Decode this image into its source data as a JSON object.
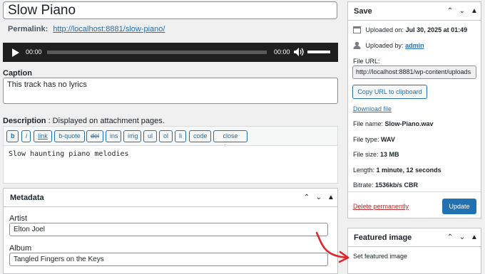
{
  "title": "Slow Piano",
  "permalink": {
    "label": "Permalink:",
    "url": "http://localhost:8881/slow-piano/"
  },
  "audio": {
    "current_time": "00:00",
    "duration": "00:00"
  },
  "caption": {
    "label": "Caption",
    "value": "This track has no lyrics"
  },
  "description": {
    "label": "Description",
    "hint": " : Displayed on attachment pages.",
    "buttons": [
      "b",
      "i",
      "link",
      "b-quote",
      "del",
      "ins",
      "img",
      "ul",
      "ol",
      "li",
      "code",
      "close tags"
    ],
    "value": "Slow haunting piano melodies"
  },
  "metadata": {
    "title": "Metadata",
    "artist_label": "Artist",
    "artist_value": "Elton Joel",
    "album_label": "Album",
    "album_value": "Tangled Fingers on the Keys"
  },
  "save": {
    "title": "Save",
    "uploaded_on_label": "Uploaded on:",
    "uploaded_on_value": "Jul 30, 2025 at 01:49",
    "uploaded_by_label": "Uploaded by:",
    "uploaded_by_value": "admin",
    "file_url_label": "File URL:",
    "file_url_value": "http://localhost:8881/wp-content/uploads",
    "copy_button": "Copy URL to clipboard",
    "download_link": "Download file",
    "file_name_label": "File name:",
    "file_name_value": "Slow-Piano.wav",
    "file_type_label": "File type:",
    "file_type_value": "WAV",
    "file_size_label": "File size:",
    "file_size_value": "13 MB",
    "length_label": "Length:",
    "length_value": "1 minute, 12 seconds",
    "bitrate_label": "Bitrate:",
    "bitrate_value": "1536kb/s CBR",
    "delete_link": "Delete permanently",
    "update_button": "Update"
  },
  "featured_image": {
    "title": "Featured image",
    "set_link": "Set featured image"
  },
  "colors": {
    "accent": "#2271b1",
    "delete": "#b32d2e",
    "annotation_arrow": "#e0262a"
  }
}
